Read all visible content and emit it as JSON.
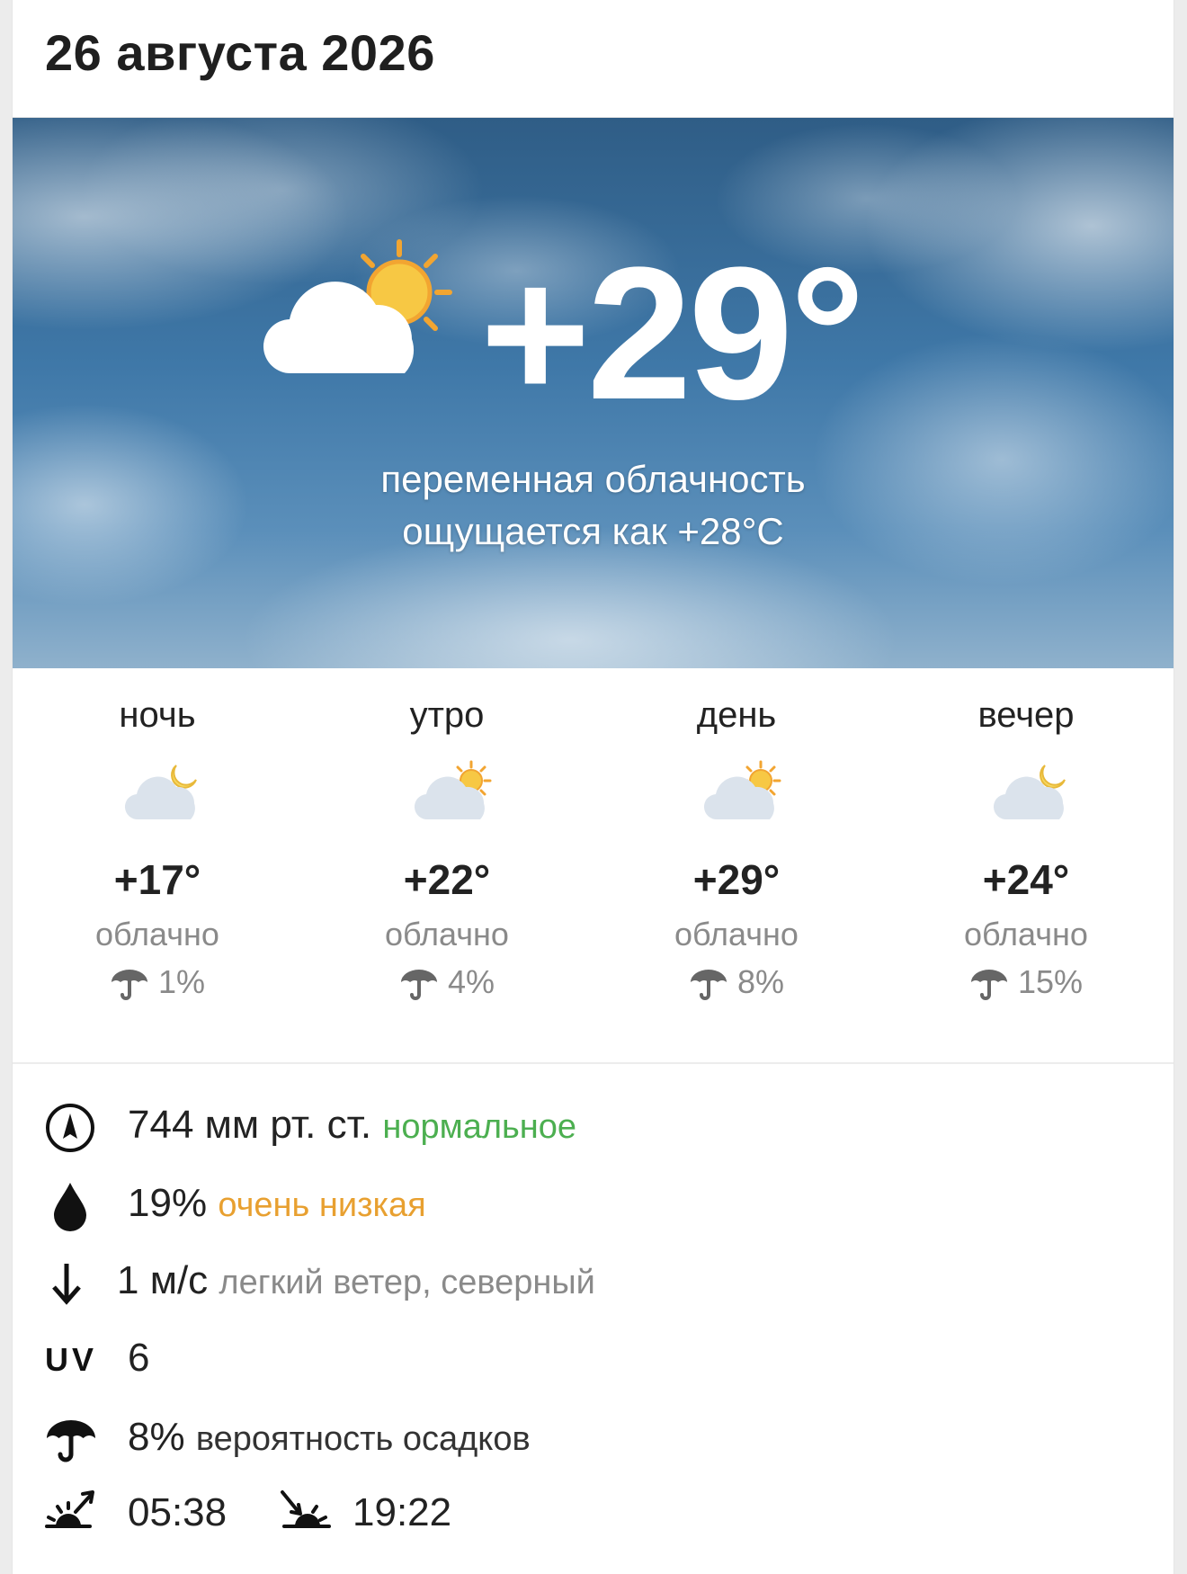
{
  "date": "26 августа 2026",
  "current": {
    "temperature": "+29°",
    "condition": "переменная облачность",
    "feels_like": "ощущается как +28°C",
    "icon": "cloud-sun-icon"
  },
  "periods": [
    {
      "name": "ночь",
      "icon": "cloud-moon-icon",
      "temp": "+17°",
      "condition": "облачно",
      "rain": "1%"
    },
    {
      "name": "утро",
      "icon": "cloud-sun-icon",
      "temp": "+22°",
      "condition": "облачно",
      "rain": "4%"
    },
    {
      "name": "день",
      "icon": "cloud-sun-icon",
      "temp": "+29°",
      "condition": "облачно",
      "rain": "8%"
    },
    {
      "name": "вечер",
      "icon": "cloud-moon-icon",
      "temp": "+24°",
      "condition": "облачно",
      "rain": "15%"
    }
  ],
  "details": {
    "pressure": {
      "value": "744 мм рт. ст.",
      "status": "нормальное",
      "status_color": "#4caf50"
    },
    "humidity": {
      "value": "19%",
      "status": "очень низкая",
      "status_color": "#e8a030"
    },
    "wind": {
      "value": "1 м/с",
      "description": "легкий ветер, северный"
    },
    "uv": {
      "label": "UV",
      "value": "6"
    },
    "precipitation": {
      "value": "8%",
      "description": "вероятность осадков"
    },
    "sunrise": "05:38",
    "sunset": "19:22"
  }
}
